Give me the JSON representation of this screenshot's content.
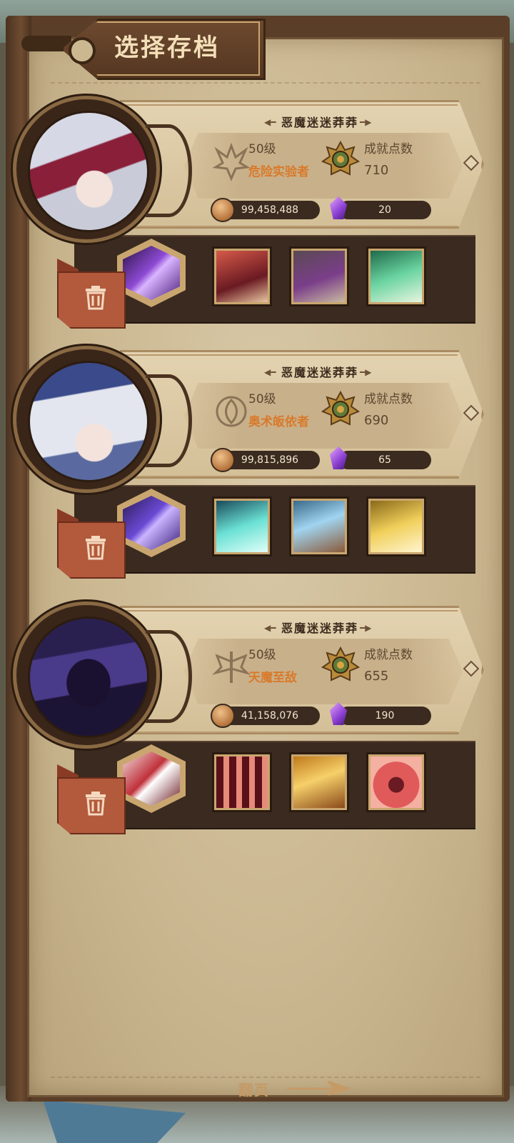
{
  "title": "选择存档",
  "page_turn_label": "翻页",
  "colors": {
    "class_text": "#d97a2a",
    "paper": "#cbb891",
    "dark_band": "#3a2a1f"
  },
  "slots": [
    {
      "name": "恶魔迷迷莽莽",
      "level": "50级",
      "class_name": "危险实验者",
      "achievement_label": "成就点数",
      "achievement_points": "710",
      "gold": "99,458,488",
      "gems": "20",
      "emblem_icon": "horned-emblem-icon",
      "skills": [
        "purple-lightning-skill",
        "red-demon-skill",
        "shadow-face-skill",
        "green-rune-skill"
      ]
    },
    {
      "name": "恶魔迷迷莽莽",
      "level": "50级",
      "class_name": "奥术皈依者",
      "achievement_label": "成就点数",
      "achievement_points": "690",
      "gold": "99,815,896",
      "gems": "65",
      "emblem_icon": "arcane-emblem-icon",
      "skills": [
        "violet-crystal-skill",
        "teal-burst-skill",
        "ice-shard-skill",
        "golden-sword-skill"
      ]
    },
    {
      "name": "恶魔迷迷莽莽",
      "level": "50级",
      "class_name": "天魔至敌",
      "achievement_label": "成就点数",
      "achievement_points": "655",
      "gold": "41,158,076",
      "gems": "190",
      "emblem_icon": "winged-sword-emblem-icon",
      "skills": [
        "crimson-slash-skill",
        "red-claw-skill",
        "golden-flare-skill",
        "red-vortex-skill"
      ]
    }
  ]
}
